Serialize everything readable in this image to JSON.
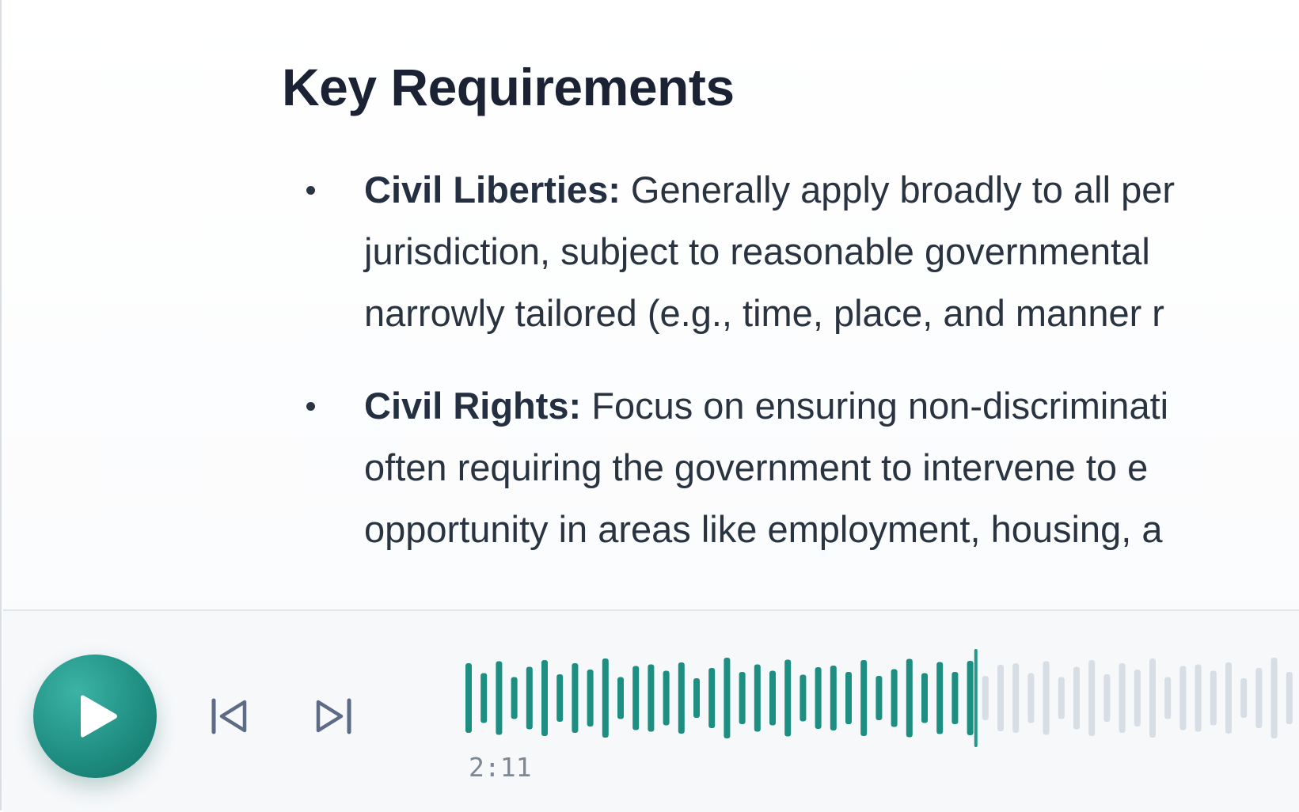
{
  "document": {
    "heading": "Key Requirements",
    "bullets": [
      {
        "term": "Civil Liberties:",
        "lines": [
          " Generally apply broadly to all per",
          "jurisdiction, subject to reasonable governmental",
          "narrowly tailored (e.g., time, place, and manner r"
        ]
      },
      {
        "term": "Civil Rights:",
        "lines": [
          " Focus on ensuring non-discriminati",
          "often requiring the government to intervene to e",
          "opportunity in areas like employment, housing, a"
        ]
      }
    ]
  },
  "player": {
    "elapsed": "2:11",
    "progress_fraction": 0.61,
    "colors": {
      "played": "#1d8f82",
      "unplayed": "#d8dee6",
      "accent": "#22988a",
      "control": "#5d6b86"
    },
    "icons": {
      "play": "play-icon",
      "previous": "skip-previous-icon",
      "next": "skip-next-icon"
    }
  }
}
